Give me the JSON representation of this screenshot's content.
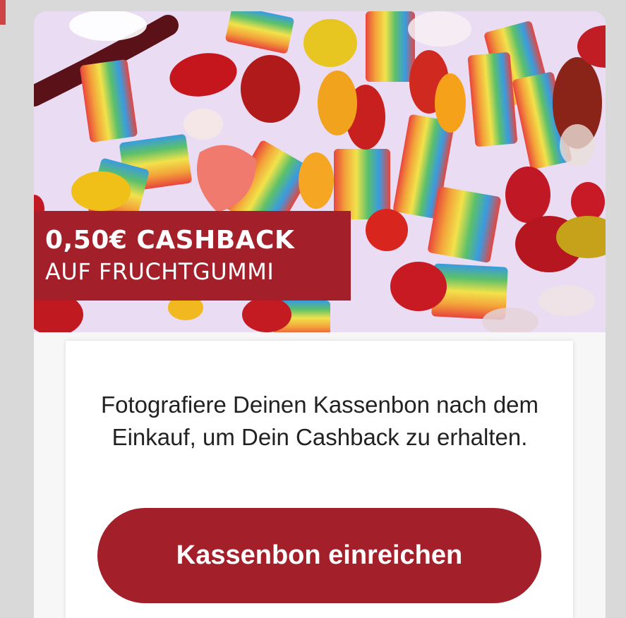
{
  "offer": {
    "badge_line1": "0,50€ CASHBACK",
    "badge_line2": "AUF FRUCHTGUMMI",
    "image_alt": "Gummy candy",
    "accent_color": "#a3202b"
  },
  "instructions": {
    "text": "Fotografiere Deinen Kassenbon nach dem Einkauf, um Dein Cashback zu erhalten."
  },
  "actions": {
    "submit_label": "Kassenbon einreichen"
  }
}
